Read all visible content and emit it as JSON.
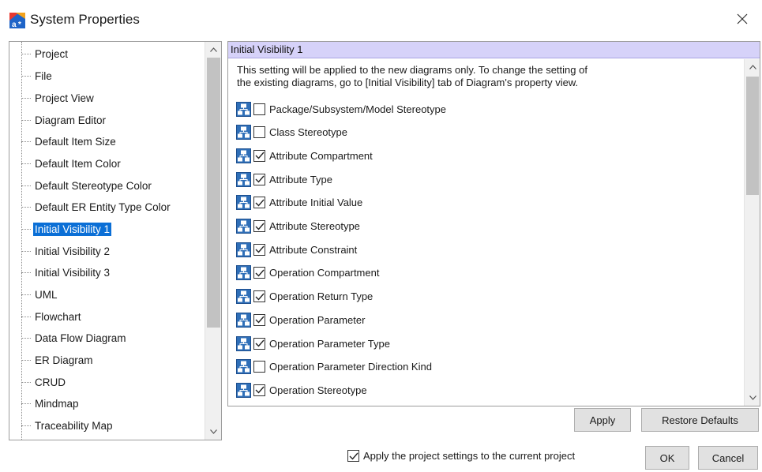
{
  "window": {
    "title": "System Properties",
    "app_icon": "astah-logo-icon",
    "close_icon": "close-icon"
  },
  "tree": {
    "items": [
      {
        "label": "Project",
        "selected": false
      },
      {
        "label": "File",
        "selected": false
      },
      {
        "label": "Project View",
        "selected": false
      },
      {
        "label": "Diagram Editor",
        "selected": false
      },
      {
        "label": "Default Item Size",
        "selected": false
      },
      {
        "label": "Default Item Color",
        "selected": false
      },
      {
        "label": "Default Stereotype Color",
        "selected": false
      },
      {
        "label": "Default ER Entity Type Color",
        "selected": false
      },
      {
        "label": "Initial Visibility 1",
        "selected": true
      },
      {
        "label": "Initial Visibility 2",
        "selected": false
      },
      {
        "label": "Initial Visibility 3",
        "selected": false
      },
      {
        "label": "UML",
        "selected": false
      },
      {
        "label": "Flowchart",
        "selected": false
      },
      {
        "label": "Data Flow Diagram",
        "selected": false
      },
      {
        "label": "ER Diagram",
        "selected": false
      },
      {
        "label": "CRUD",
        "selected": false
      },
      {
        "label": "Mindmap",
        "selected": false
      },
      {
        "label": "Traceability Map",
        "selected": false
      }
    ],
    "scroll_up_icon": "chevron-up-icon",
    "scroll_down_icon": "chevron-down-icon"
  },
  "content": {
    "section_title": "Initial Visibility 1",
    "description_line1": "This setting will be applied to the new diagrams only. To change the setting of",
    "description_line2": "the existing diagrams, go to [Initial Visibility] tab of Diagram's property view.",
    "options": [
      {
        "label": "Package/Subsystem/Model Stereotype",
        "checked": false
      },
      {
        "label": "Class Stereotype",
        "checked": false
      },
      {
        "label": "Attribute Compartment",
        "checked": true
      },
      {
        "label": "Attribute Type",
        "checked": true
      },
      {
        "label": "Attribute Initial Value",
        "checked": true
      },
      {
        "label": "Attribute Stereotype",
        "checked": true
      },
      {
        "label": "Attribute Constraint",
        "checked": true
      },
      {
        "label": "Operation Compartment",
        "checked": true
      },
      {
        "label": "Operation Return Type",
        "checked": true
      },
      {
        "label": "Operation Parameter",
        "checked": true
      },
      {
        "label": "Operation Parameter Type",
        "checked": true
      },
      {
        "label": "Operation Parameter Direction Kind",
        "checked": false
      },
      {
        "label": "Operation Stereotype",
        "checked": true
      }
    ],
    "option_icon": "diagram-icon"
  },
  "buttons": {
    "apply": "Apply",
    "restore_defaults": "Restore Defaults",
    "ok": "OK",
    "cancel": "Cancel"
  },
  "footer": {
    "apply_project_label": "Apply the project settings to the current project",
    "apply_project_checked": true
  },
  "colors": {
    "selection": "#0b6fd6",
    "section_header_bg": "#d6d2f9",
    "button_bg": "#e1e1e1",
    "icon_blue": "#2f6fb8"
  }
}
